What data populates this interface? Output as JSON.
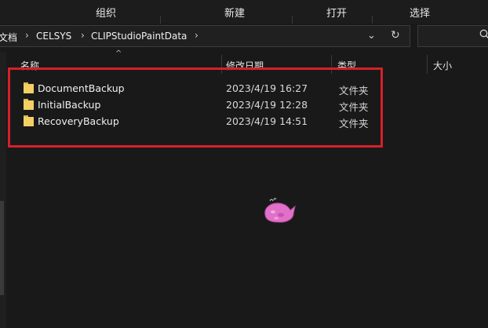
{
  "ribbon": {
    "organize": "组织",
    "new": "新建",
    "open": "打开",
    "select": "选择"
  },
  "address": {
    "crumbs": [
      "文档",
      "CELSYS",
      "CLIPStudioPaintData"
    ]
  },
  "columns": {
    "name": "名称",
    "date": "修改日期",
    "type": "类型",
    "size": "大小"
  },
  "files": [
    {
      "name": "DocumentBackup",
      "date": "2023/4/19 16:27",
      "type": "文件夹"
    },
    {
      "name": "InitialBackup",
      "date": "2023/4/19 12:28",
      "type": "文件夹"
    },
    {
      "name": "RecoveryBackup",
      "date": "2023/4/19 14:51",
      "type": "文件夹"
    }
  ],
  "icons": {
    "folder": "folder-icon",
    "chevron": "chevron-right-icon",
    "dropdown": "chevron-down-icon",
    "refresh": "refresh-icon",
    "search": "search-icon",
    "sort": "sort-up-icon"
  },
  "colors": {
    "background": "#191919",
    "highlight": "#d4212a",
    "folder": "#f4cf64"
  }
}
